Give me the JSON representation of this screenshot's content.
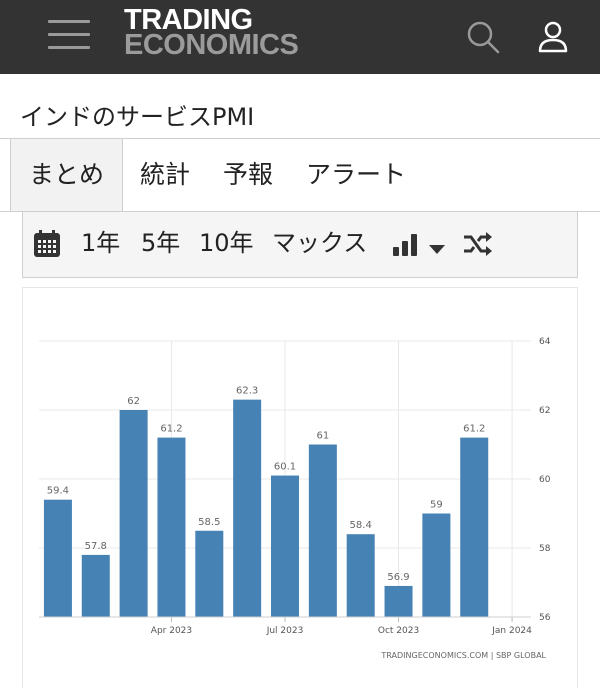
{
  "header": {
    "logo_line1": "TRADING",
    "logo_line2": "ECONOMICS"
  },
  "page": {
    "title": "インドのサービスPMI"
  },
  "tabs": [
    {
      "label": "まとめ",
      "active": true
    },
    {
      "label": "統計",
      "active": false
    },
    {
      "label": "予報",
      "active": false
    },
    {
      "label": "アラート",
      "active": false
    }
  ],
  "toolbar": {
    "ranges": [
      "1年",
      "5年",
      "10年",
      "マックス"
    ]
  },
  "colors": {
    "bar": "#4682b4",
    "topbar": "#333333"
  },
  "chart_data": {
    "type": "bar",
    "categories": [
      "Jan 2023",
      "Feb 2023",
      "Mar 2023",
      "Apr 2023",
      "May 2023",
      "Jun 2023",
      "Jul 2023",
      "Aug 2023",
      "Sep 2023",
      "Oct 2023",
      "Nov 2023",
      "Dec 2023",
      "Jan 2024"
    ],
    "values": [
      59.4,
      57.8,
      62,
      61.2,
      58.5,
      62.3,
      60.1,
      61,
      58.4,
      56.9,
      59,
      61.2
    ],
    "x_tick_labels": [
      "Apr 2023",
      "Jul 2023",
      "Oct 2023",
      "Jan 2024"
    ],
    "y_ticks": [
      56,
      58,
      60,
      62,
      64
    ],
    "ylim": [
      56,
      64
    ],
    "grid": true,
    "y_axis_side": "right",
    "source": "TRADINGECONOMICS.COM | SBP GLOBAL"
  }
}
